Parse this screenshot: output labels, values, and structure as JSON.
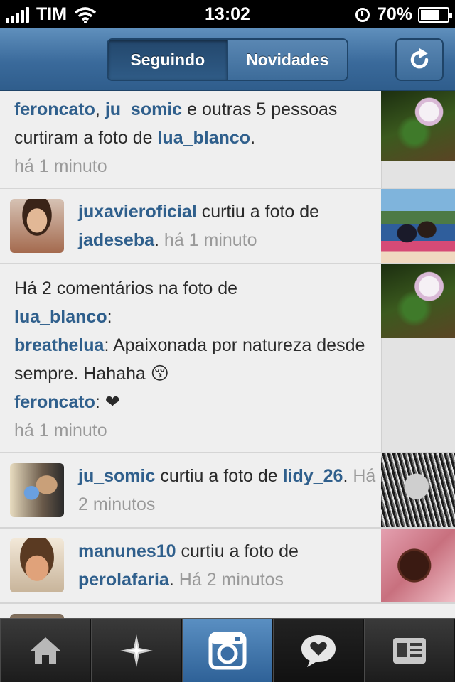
{
  "status_bar": {
    "carrier": "TIM",
    "time": "13:02",
    "battery": "70%",
    "battery_level": 0.7
  },
  "nav": {
    "tab_following": "Seguindo",
    "tab_news": "Novidades",
    "refresh_icon": "refresh-icon"
  },
  "feed": [
    {
      "user1": "feroncato",
      "sep1": ", ",
      "user2": "ju_somic",
      "text1": " e outras 5 pessoas curtiram a foto de ",
      "user3": "lua_blanco",
      "text2": ".",
      "time": "há 1 minuto"
    },
    {
      "user1": "juxavieroficial",
      "text1": " curtiu a foto de ",
      "user2": "jadeseba",
      "text2": ". ",
      "time": "há 1 minuto"
    },
    {
      "text1": "Há 2 comentários na foto de ",
      "user1": "lua_blanco",
      "text2": ":",
      "c1_user": "breathelua",
      "c1_text": ": Apaixonada por natureza desde sempre. Hahaha 😚",
      "c2_user": "feroncato",
      "c2_text": ": ❤",
      "time": "há 1 minuto"
    },
    {
      "user1": "ju_somic",
      "text1": " curtiu a foto de ",
      "user2": "lidy_26",
      "text2": ". ",
      "time": "Há 2 minutos"
    },
    {
      "user1": "manunes10",
      "text1": " curtiu a foto de ",
      "user2": "perolafaria",
      "text2": ". ",
      "time": "Há 2 minutos"
    }
  ],
  "tabbar": {
    "items": [
      "home-icon",
      "explore-icon",
      "camera-icon",
      "news-icon",
      "profile-icon"
    ]
  },
  "colors": {
    "nav_blue": "#3a6a9b",
    "link_blue": "#2f5f8c",
    "muted": "#9a9a9a"
  }
}
